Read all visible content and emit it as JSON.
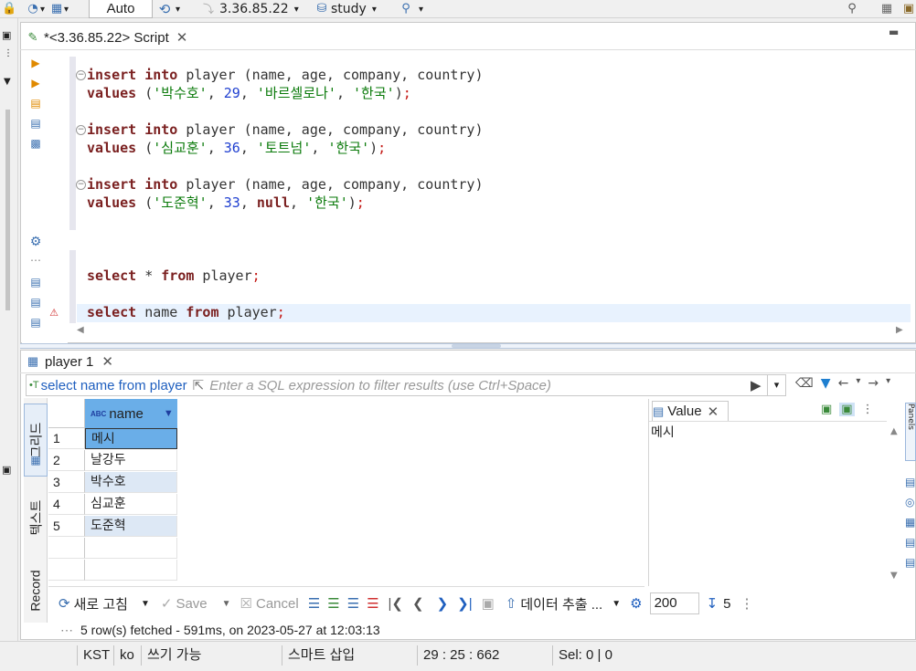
{
  "toolbar": {
    "auto_label": "Auto",
    "connection_label": "3.36.85.22",
    "database_label": "study"
  },
  "editor": {
    "tab_title": "*<3.36.85.22> Script",
    "lines": [
      {
        "tokens": [
          [
            "kw",
            "insert"
          ],
          [
            "tx",
            " "
          ],
          [
            "kw",
            "into"
          ],
          [
            "tx",
            " player (name, age, company, country)"
          ]
        ]
      },
      {
        "tokens": [
          [
            "kw",
            "values"
          ],
          [
            "tx",
            " ("
          ],
          [
            "str",
            "'박수호'"
          ],
          [
            "tx",
            ", "
          ],
          [
            "num",
            "29"
          ],
          [
            "tx",
            ", "
          ],
          [
            "str",
            "'바르셀로나'"
          ],
          [
            "tx",
            ", "
          ],
          [
            "str",
            "'한국'"
          ],
          [
            "tx",
            ")"
          ],
          [
            "sym",
            ";"
          ]
        ]
      },
      {
        "tokens": [
          [
            "kw",
            "insert"
          ],
          [
            "tx",
            " "
          ],
          [
            "kw",
            "into"
          ],
          [
            "tx",
            " player (name, age, company, country)"
          ]
        ]
      },
      {
        "tokens": [
          [
            "kw",
            "values"
          ],
          [
            "tx",
            " ("
          ],
          [
            "str",
            "'심교훈'"
          ],
          [
            "tx",
            ", "
          ],
          [
            "num",
            "36"
          ],
          [
            "tx",
            ", "
          ],
          [
            "str",
            "'토트넘'"
          ],
          [
            "tx",
            ", "
          ],
          [
            "str",
            "'한국'"
          ],
          [
            "tx",
            ")"
          ],
          [
            "sym",
            ";"
          ]
        ]
      },
      {
        "tokens": [
          [
            "kw",
            "insert"
          ],
          [
            "tx",
            " "
          ],
          [
            "kw",
            "into"
          ],
          [
            "tx",
            " player (name, age, company, country)"
          ]
        ]
      },
      {
        "tokens": [
          [
            "kw",
            "values"
          ],
          [
            "tx",
            " ("
          ],
          [
            "str",
            "'도준혁'"
          ],
          [
            "tx",
            ", "
          ],
          [
            "num",
            "33"
          ],
          [
            "tx",
            ", "
          ],
          [
            "kw",
            "null"
          ],
          [
            "tx",
            ", "
          ],
          [
            "str",
            "'한국'"
          ],
          [
            "tx",
            ")"
          ],
          [
            "sym",
            ";"
          ]
        ]
      },
      {
        "tokens": [
          [
            "kw",
            "select"
          ],
          [
            "tx",
            " * "
          ],
          [
            "kw",
            "from"
          ],
          [
            "tx",
            " player"
          ],
          [
            "sym",
            ";"
          ]
        ]
      },
      {
        "tokens": [
          [
            "kw",
            "select"
          ],
          [
            "tx",
            " name "
          ],
          [
            "kw",
            "from"
          ],
          [
            "tx",
            " player"
          ],
          [
            "sym",
            ";"
          ]
        ]
      }
    ]
  },
  "results": {
    "tab_title": "player 1",
    "query_text": "select name from player",
    "filter_placeholder": "Enter a SQL expression to filter results (use Ctrl+Space)",
    "side_tabs": [
      "그리드",
      "텍스트",
      "Record"
    ],
    "column_header": "name",
    "rows": [
      {
        "num": "1",
        "name": "메시"
      },
      {
        "num": "2",
        "name": "날강두"
      },
      {
        "num": "3",
        "name": "박수호"
      },
      {
        "num": "4",
        "name": "심교훈"
      },
      {
        "num": "5",
        "name": "도준혁"
      }
    ],
    "value_panel": {
      "tab_title": "Value",
      "content": "메시"
    },
    "bottom_toolbar": {
      "refresh_label": "새로 고침",
      "save_label": "Save",
      "cancel_label": "Cancel",
      "export_label": "데이터 추출 ...",
      "fetch_size": "200",
      "row_count": "5"
    },
    "fetch_status": "5 row(s) fetched - 591ms, on 2023-05-27 at 12:03:13"
  },
  "statusbar": {
    "timezone": "KST",
    "locale": "ko",
    "write_mode": "쓰기 가능",
    "insert_mode": "스마트 삽입",
    "cursor_pos": "29 : 25 : 662",
    "selection": "Sel: 0 | 0"
  }
}
